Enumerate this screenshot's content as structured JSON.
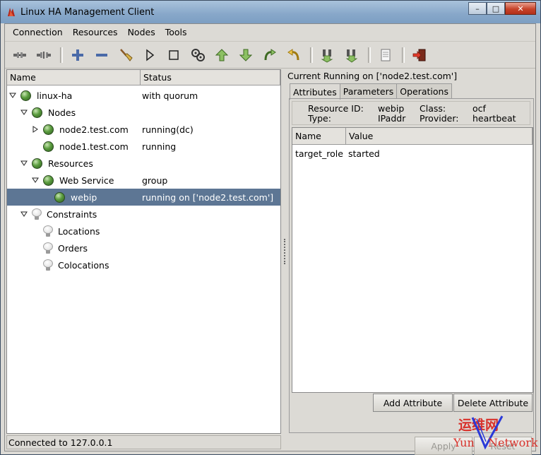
{
  "window": {
    "title": "Linux HA Management Client",
    "minimize_glyph": "–",
    "maximize_glyph": "□",
    "close_glyph": "✕"
  },
  "menu": [
    "Connection",
    "Resources",
    "Nodes",
    "Tools"
  ],
  "toolbar": [
    "connect-icon",
    "disconnect-icon",
    "add-icon",
    "remove-icon",
    "cleanup-icon",
    "start-icon",
    "stop-icon",
    "default-icon",
    "move-up-icon",
    "move-down-icon",
    "migrate-icon",
    "unmigrate-icon",
    "standby-icon",
    "active-icon",
    "view-log-icon",
    "exit-icon"
  ],
  "tree": {
    "columns": [
      "Name",
      "Status"
    ],
    "rows": [
      {
        "name": "linux-ha",
        "status": "with quorum"
      },
      {
        "name": "Nodes",
        "status": ""
      },
      {
        "name": "node2.test.com",
        "status": "running(dc)"
      },
      {
        "name": "node1.test.com",
        "status": "running"
      },
      {
        "name": "Resources",
        "status": ""
      },
      {
        "name": "Web Service",
        "status": "group"
      },
      {
        "name": "webip",
        "status": "running on ['node2.test.com']"
      },
      {
        "name": "Constraints",
        "status": ""
      },
      {
        "name": "Locations",
        "status": ""
      },
      {
        "name": "Orders",
        "status": ""
      },
      {
        "name": "Colocations",
        "status": ""
      }
    ]
  },
  "detail": {
    "title": "Current Running on ['node2.test.com']",
    "tabs": [
      "Attributes",
      "Parameters",
      "Operations"
    ],
    "info": {
      "resource_id_label": "Resource ID:",
      "resource_id": "webip",
      "type_label": "Type:",
      "type": "IPaddr",
      "class_label": "Class:",
      "class": "ocf",
      "provider_label": "Provider:",
      "provider": "heartbeat"
    },
    "columns": [
      "Name",
      "Value"
    ],
    "attributes": [
      {
        "name": "target_role",
        "value": "started"
      }
    ],
    "add_button": "Add Attribute",
    "delete_button": "Delete Attribute",
    "apply_button": "Apply",
    "reset_button": "Reset"
  },
  "statusbar": "Connected to 127.0.0.1",
  "watermark": {
    "cn": "运维网",
    "en1": "Yun",
    "en2": "Network"
  }
}
